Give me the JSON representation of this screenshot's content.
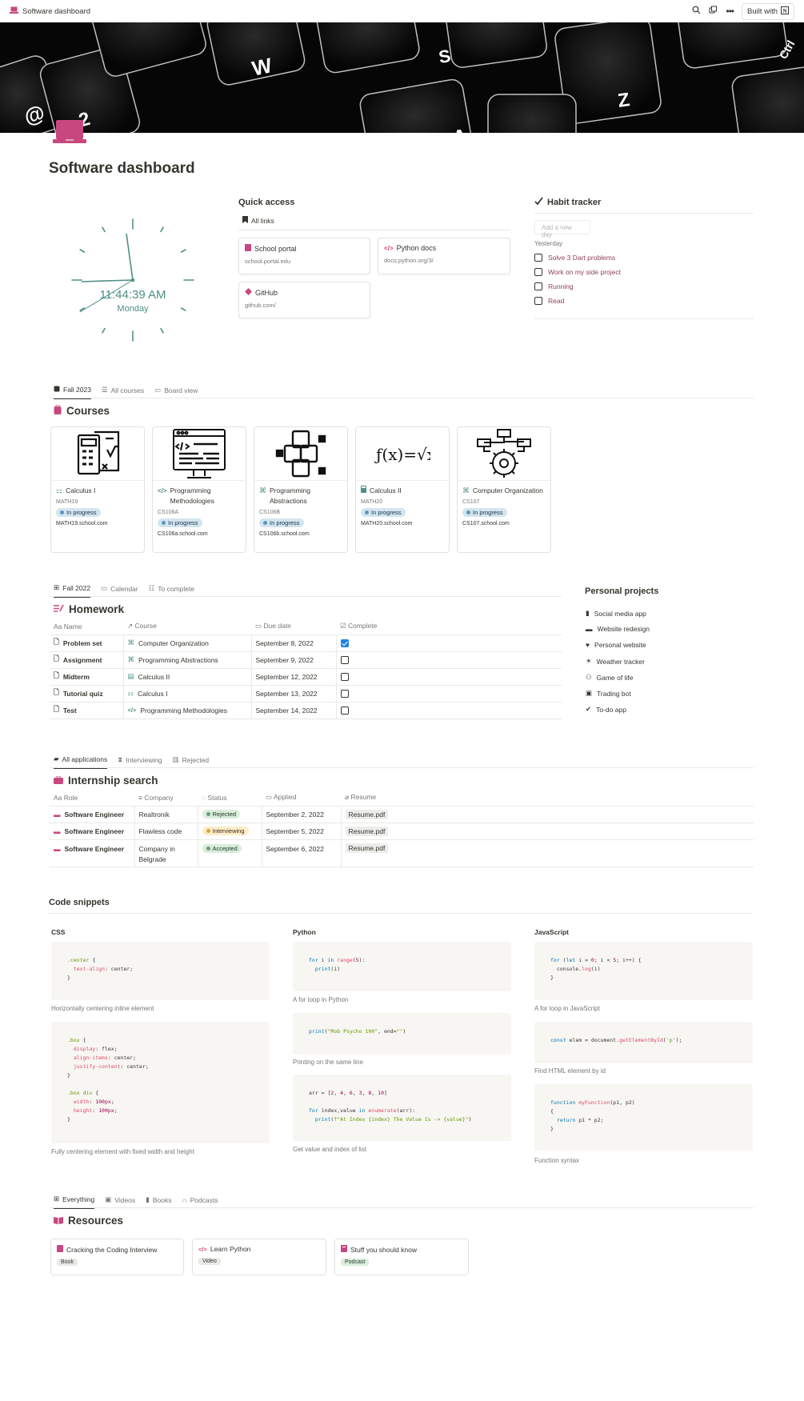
{
  "topbar": {
    "title": "Software dashboard",
    "built_with": "Built with"
  },
  "page": {
    "title": "Software dashboard"
  },
  "clock": {
    "time": "11:44:39 AM",
    "day": "Monday"
  },
  "quick_access": {
    "title": "Quick access",
    "all_links": "All links",
    "links": [
      {
        "label": "School portal",
        "url": "school.portal.edu"
      },
      {
        "label": "Python docs",
        "url": "docs.python.org/3/"
      },
      {
        "label": "GitHub",
        "url": "github.com/"
      }
    ]
  },
  "habit": {
    "title": "Habit tracker",
    "placeholder": "Add a new day",
    "date": "Yesterday",
    "items": [
      "Solve 3 Dart problems",
      "Work on my side project",
      "Running",
      "Read"
    ]
  },
  "courses_tabs": [
    "Fall 2023",
    "All courses",
    "Board view"
  ],
  "courses": {
    "title": "Courses",
    "items": [
      {
        "name": "Calculus I",
        "code": "MATH19",
        "status": "In progress",
        "link": "MATH19.school.com"
      },
      {
        "name": "Programming Methodologies",
        "code": "CS106A",
        "status": "In progress",
        "link": "CS106a.school.com"
      },
      {
        "name": "Programming Abstractions",
        "code": "CS106B",
        "status": "In progress",
        "link": "CS106b.school.com"
      },
      {
        "name": "Calculus II",
        "code": "MATH20",
        "status": "In progress",
        "link": "MATH20.school.com"
      },
      {
        "name": "Computer Organization",
        "code": "CS107",
        "status": "In progress",
        "link": "CS107.school.com"
      }
    ]
  },
  "hw_tabs": [
    "Fall 2022",
    "Calendar",
    "To complete"
  ],
  "homework": {
    "title": "Homework",
    "columns": [
      "Name",
      "Course",
      "Due date",
      "Complete"
    ],
    "rows": [
      {
        "name": "Problem set",
        "course": "Computer Organization",
        "due": "September 8, 2022",
        "done": true
      },
      {
        "name": "Assignment",
        "course": "Programming Abstractions",
        "due": "September 9, 2022",
        "done": false
      },
      {
        "name": "Midterm",
        "course": "Calculus II",
        "due": "September 12, 2022",
        "done": false
      },
      {
        "name": "Tutorial quiz",
        "course": "Calculus I",
        "due": "September 13, 2022",
        "done": false
      },
      {
        "name": "Test",
        "course": "Programming Methodologies",
        "due": "September 14, 2022",
        "done": false
      }
    ]
  },
  "projects": {
    "title": "Personal projects",
    "items": [
      "Social media app",
      "Website redesign",
      "Personal website",
      "Weather tracker",
      "Game of life",
      "Trading bot",
      "To-do app"
    ]
  },
  "app_tabs": [
    "All applications",
    "Interviewing",
    "Rejected"
  ],
  "internship": {
    "title": "Internship search",
    "columns": [
      "Role",
      "Company",
      "Status",
      "Applied",
      "Resume"
    ],
    "rows": [
      {
        "role": "Software Engineer",
        "company": "Realtronik",
        "status": "Rejected",
        "applied": "September 2, 2022",
        "resume": "Resume.pdf"
      },
      {
        "role": "Software Engineer",
        "company": "Flawless code",
        "status": "Interviewing",
        "applied": "September 5, 2022",
        "resume": "Resume.pdf"
      },
      {
        "role": "Software Engineer",
        "company": "Company in Belgrade",
        "status": "Accepted",
        "applied": "September 6, 2022",
        "resume": "Resume.pdf"
      }
    ]
  },
  "snippets": {
    "title": "Code snippets",
    "langs": [
      "CSS",
      "Python",
      "JavaScript"
    ],
    "captions": {
      "css1": "Horizontally centering inline element",
      "css2": "Fully centering element with fixed width and height",
      "py1": "A for loop in Python",
      "py2": "Printing on the same line",
      "py3": "Get value and index of list",
      "js1": "A for loop in JavaScript",
      "js2": "Find HTML element by id",
      "js3": "Function syntax"
    }
  },
  "res_tabs": [
    "Everything",
    "Videos",
    "Books",
    "Podcasts"
  ],
  "resources": {
    "title": "Resources",
    "items": [
      {
        "name": "Cracking the Coding Interview",
        "tag": "Book"
      },
      {
        "name": "Learn Python",
        "tag": "Video"
      },
      {
        "name": "Stuff you should know",
        "tag": "Podcast"
      }
    ]
  },
  "colors": {
    "accent": "#c9477f",
    "clock": "#4f8f86",
    "check": "#2383e2"
  }
}
